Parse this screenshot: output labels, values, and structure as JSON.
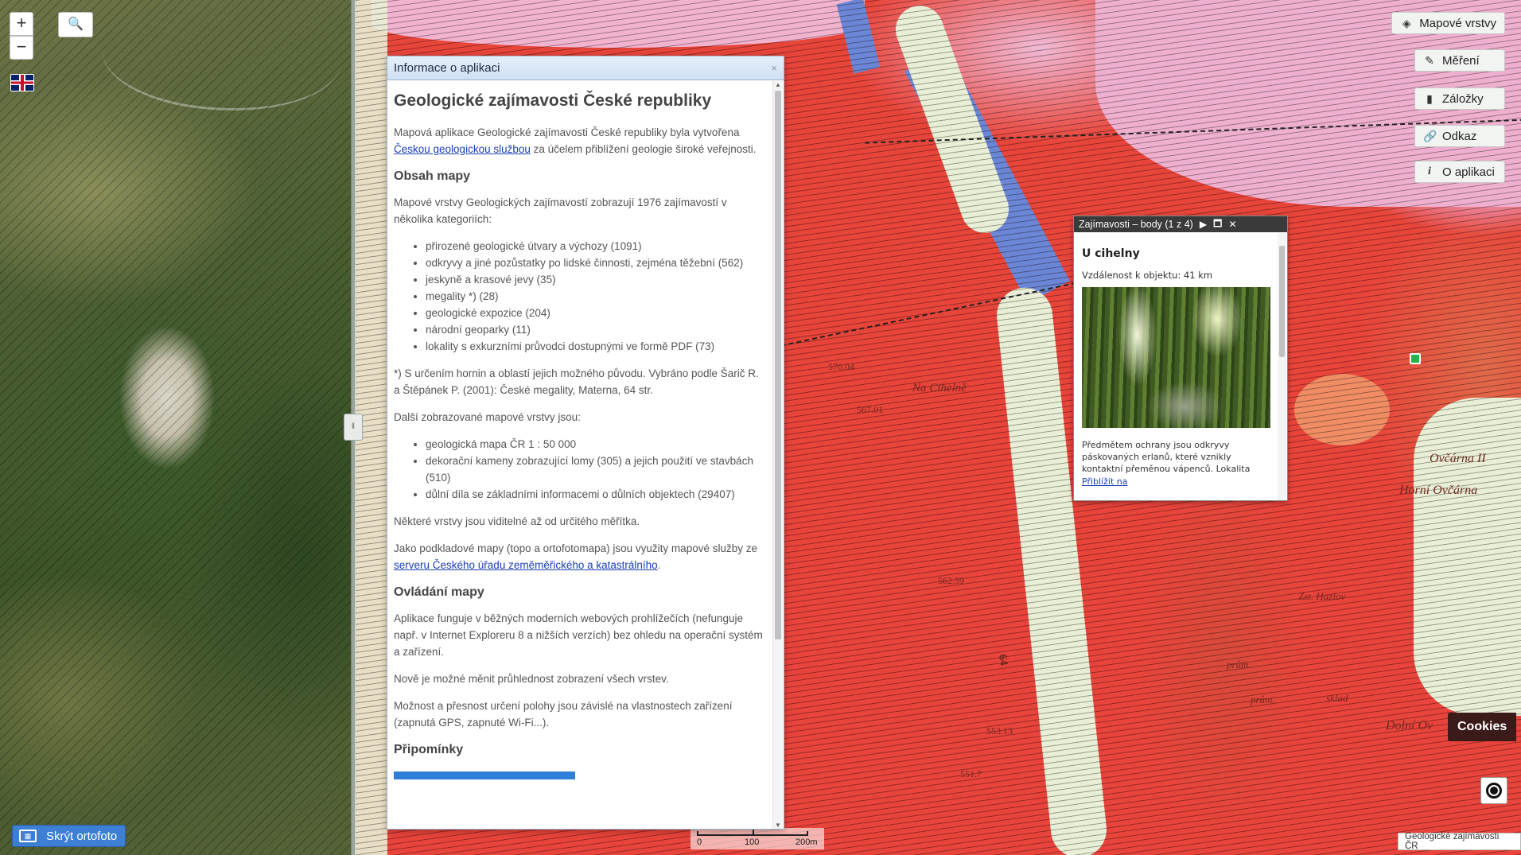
{
  "map_controls": {
    "zoom_in": "+",
    "zoom_out": "−",
    "search_icon": "🔍"
  },
  "map_labels": {
    "na_cihelne": "Na Cihelně",
    "horni_ovcarna": "Horní Ovčárna",
    "ovcarna": "Ovčárna II",
    "dolni_ovcarna": "Dolní Ov",
    "zst_hazlov": "Zst. Hazlov",
    "elev1": "570.04",
    "elev2": "567.01",
    "elev3": "562.59",
    "elev4": "553.13",
    "elev5": "551.7",
    "prum1": "prům.",
    "prum2": "prům.",
    "sklad": "sklad",
    "road64": "64"
  },
  "toolbar": {
    "layers": "Mapové vrstvy",
    "measure": "Měření",
    "bookmarks": "Záložky",
    "link": "Odkaz",
    "about": "O aplikaci"
  },
  "info_panel": {
    "header": "Informace o aplikaci",
    "close": "×",
    "title": "Geologické zajímavosti České republiky",
    "intro_pre": "Mapová aplikace Geologické zajímavosti České republiky byla vytvořena ",
    "intro_link": "Českou geologickou službou",
    "intro_post": " za účelem přiblížení geologie široké veřejnosti.",
    "h_content": "Obsah mapy",
    "content_p": "Mapové vrstvy Geologických zajímavostí zobrazují 1976 zajímavostí v několika kategoriích:",
    "categories": [
      "přirozené geologické útvary a výchozy (1091)",
      "odkryvy a jiné pozůstatky po lidské činnosti, zejména těžební (562)",
      "jeskyně a krasové jevy (35)",
      "megality *) (28)",
      "geologické expozice (204)",
      "národní geoparky (11)",
      "lokality s exkurzními průvodci dostupnými ve formě PDF (73)"
    ],
    "footnote": "*) S určením hornin a oblastí jejich možného původu. Vybráno podle Šarič R. a Štěpánek P. (2001): České megality, Materna, 64 str.",
    "other_layers_p": "Další zobrazované mapové vrstvy jsou:",
    "other_layers": [
      "geologická mapa ČR 1 : 50 000",
      "dekorační kameny zobrazující lomy (305) a jejich použití ve stavbách (510)",
      "důlní díla se základními informacemi o důlních objektech (29407)"
    ],
    "scale_note": "Některé vrstvy jsou viditelné až od určitého měřítka.",
    "basemap_pre": "Jako podkladové mapy (topo a ortofotomapa) jsou využity mapové služby ze ",
    "basemap_link": "serveru Českého úřadu zeměměřického a katastrálního",
    "basemap_post": ".",
    "h_controls": "Ovládání mapy",
    "controls_p1": "Aplikace funguje v běžných moderních webových prohlížečích (nefunguje např. v Internet Exploreru 8 a nižších verzích) bez ohledu na operační systém a zařízení.",
    "controls_p2": "Nově je možné měnit průhlednost zobrazení všech vrstev.",
    "controls_p3": "Možnost a přesnost určení polohy jsou závislé na vlastnostech zařízení (zapnutá GPS, zapnuté Wi-Fi...).",
    "h_feedback": "Připomínky"
  },
  "poi_popup": {
    "header": "Zajímavosti – body (1 z 4)",
    "next_icon": "▶",
    "maximize_icon": "🗖",
    "close_icon": "✕",
    "title": "U cihelny",
    "distance": "Vzdálenost k objektu: 41 km",
    "description": "Předmětem ochrany jsou odkryvy páskovaných erlanů, které vznikly kontaktní přeměnou vápenců. Lokalita",
    "zoom_link": "Přiblížit na"
  },
  "bottom": {
    "ortho_toggle": "Skrýt ortofoto",
    "scale_0": "0",
    "scale_100": "100",
    "scale_200": "200m",
    "cookies": "Cookies",
    "attribution": "Geologické zajímavosti ČR"
  },
  "colors": {
    "geo_red": "#e8453a",
    "geo_pink": "#efb0cf",
    "geo_blue": "#6c86d6",
    "panel_header": "#cfe0f3",
    "link": "#1a3fb8",
    "ortho_button": "#3d7fd4"
  }
}
